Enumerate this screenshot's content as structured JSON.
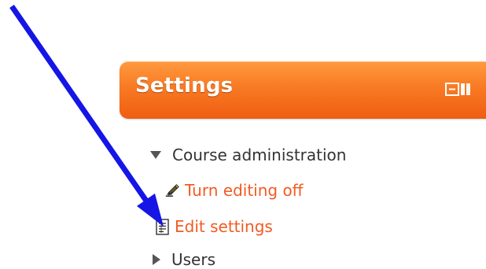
{
  "block": {
    "title": "Settings",
    "header_color": "#f16f22",
    "dock_icon": "dock-toggle-icon"
  },
  "tree": {
    "section": {
      "label": "Course administration",
      "icon": "chevron-down-icon"
    },
    "items": [
      {
        "label": "Turn editing off",
        "icon": "pencil-edit-icon",
        "color": "#f15b22"
      },
      {
        "label": "Edit settings",
        "icon": "document-settings-icon",
        "color": "#f15b22"
      },
      {
        "label": "Users",
        "icon": "chevron-right-icon",
        "color": "#333333"
      }
    ]
  },
  "annotation": {
    "arrow_color": "#1515e6",
    "arrow_icon": "pointer-arrow"
  }
}
